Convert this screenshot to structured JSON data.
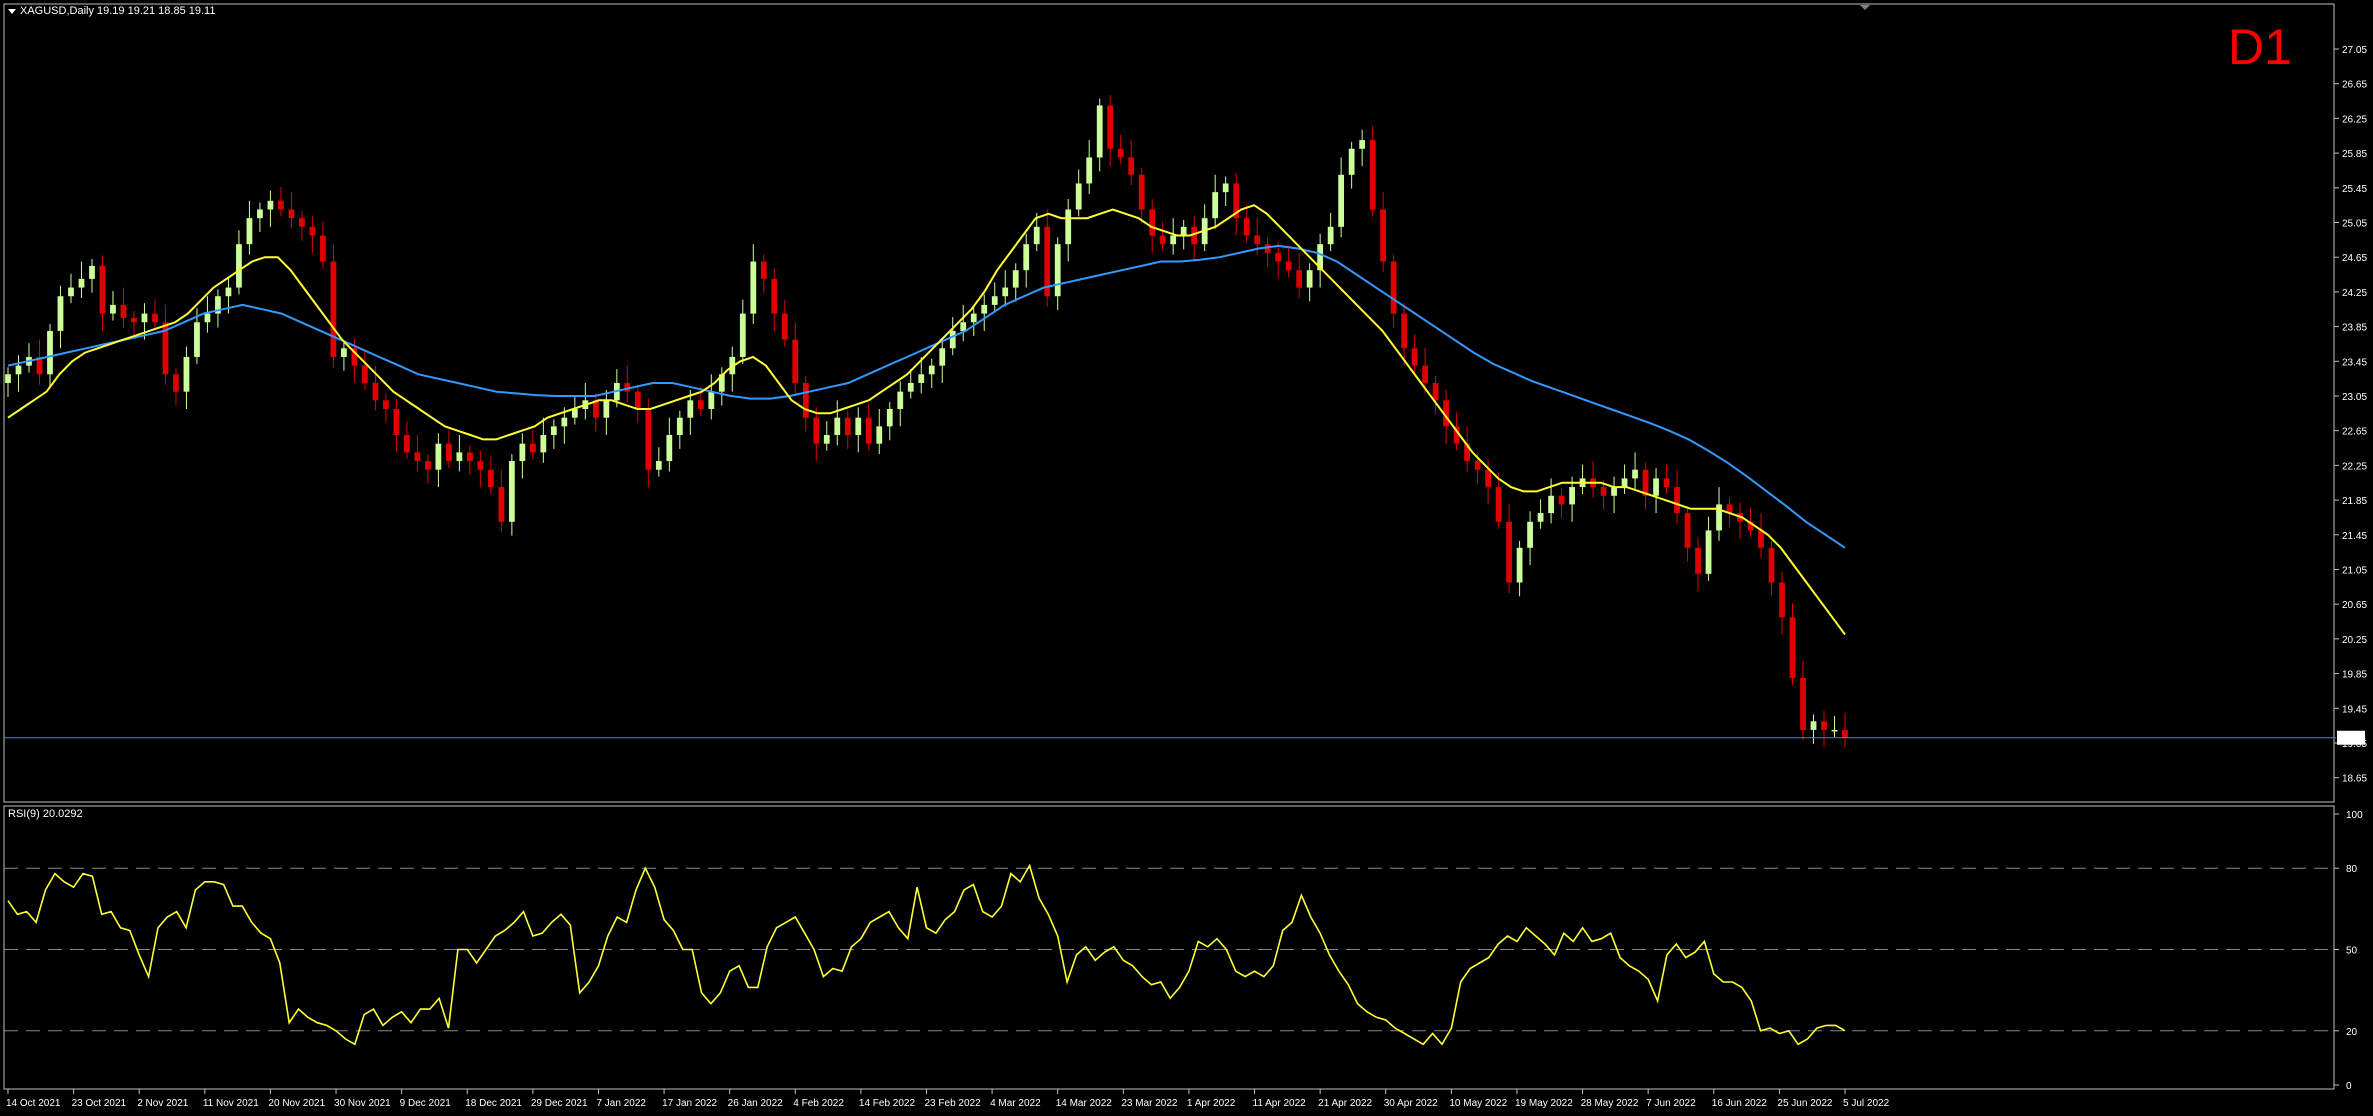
{
  "header": {
    "symbol_line": "XAGUSD,Daily  19.19 19.21 18.85 19.11",
    "timeframe_badge": "D1",
    "rsi_line": "RSI(9) 20.0292"
  },
  "colors": {
    "background": "#000000",
    "bull_candle": "#ccff99",
    "bear_candle": "#e00000",
    "fast_ma": "#ffff33",
    "slow_ma": "#3399ff",
    "rsi": "#ffff33",
    "grid_level": "#888888",
    "current_price_line": "#5a82b4"
  },
  "chart_data": [
    {
      "type": "candlestick",
      "symbol": "XAGUSD",
      "timeframe": "Daily",
      "ylim": [
        18.6,
        27.2
      ],
      "y_ticks": [
        "27.05",
        "26.65",
        "26.25",
        "25.85",
        "25.45",
        "25.05",
        "24.65",
        "24.25",
        "23.85",
        "23.45",
        "23.05",
        "22.65",
        "22.25",
        "21.85",
        "21.45",
        "21.05",
        "20.65",
        "20.25",
        "19.85",
        "19.45",
        "19.05",
        "18.65"
      ],
      "current_price": "19.11",
      "x_ticks": [
        "14 Oct 2021",
        "23 Oct 2021",
        "2 Nov 2021",
        "11 Nov 2021",
        "20 Nov 2021",
        "30 Nov 2021",
        "9 Dec 2021",
        "18 Dec 2021",
        "29 Dec 2021",
        "7 Jan 2022",
        "17 Jan 2022",
        "26 Jan 2022",
        "4 Feb 2022",
        "14 Feb 2022",
        "23 Feb 2022",
        "4 Mar 2022",
        "14 Mar 2022",
        "23 Mar 2022",
        "1 Apr 2022",
        "11 Apr 2022",
        "21 Apr 2022",
        "30 Apr 2022",
        "10 May 2022",
        "19 May 2022",
        "28 May 2022",
        "7 Jun 2022",
        "16 Jun 2022",
        "25 Jun 2022",
        "5 Jul 2022"
      ],
      "close": [
        23.3,
        23.4,
        23.5,
        23.3,
        23.8,
        24.2,
        24.3,
        24.4,
        24.55,
        24.0,
        24.1,
        23.95,
        23.9,
        24.0,
        23.9,
        23.3,
        23.1,
        23.5,
        23.9,
        24.0,
        24.2,
        24.3,
        24.8,
        25.1,
        25.2,
        25.3,
        25.2,
        25.1,
        25.0,
        24.9,
        24.6,
        23.5,
        23.6,
        23.4,
        23.2,
        23.0,
        22.9,
        22.6,
        22.4,
        22.3,
        22.2,
        22.5,
        22.3,
        22.4,
        22.3,
        22.2,
        22.0,
        21.6,
        22.3,
        22.5,
        22.4,
        22.6,
        22.7,
        22.8,
        22.9,
        23.0,
        22.8,
        23.0,
        23.2,
        23.1,
        22.9,
        22.2,
        22.3,
        22.6,
        22.8,
        23.0,
        22.9,
        23.1,
        23.3,
        23.5,
        24.0,
        24.6,
        24.4,
        24.0,
        23.7,
        23.2,
        22.8,
        22.5,
        22.6,
        22.8,
        22.6,
        22.8,
        22.5,
        22.7,
        22.9,
        23.1,
        23.2,
        23.3,
        23.4,
        23.6,
        23.8,
        23.9,
        24.0,
        24.1,
        24.2,
        24.3,
        24.5,
        24.8,
        25.0,
        24.2,
        24.8,
        25.2,
        25.5,
        25.8,
        26.4,
        25.9,
        25.8,
        25.6,
        25.2,
        24.9,
        24.8,
        24.9,
        25.0,
        24.8,
        25.1,
        25.4,
        25.5,
        25.1,
        24.9,
        24.8,
        24.7,
        24.6,
        24.5,
        24.3,
        24.5,
        24.8,
        25.0,
        25.6,
        25.9,
        26.0,
        25.2,
        24.6,
        24.0,
        23.6,
        23.4,
        23.2,
        23.0,
        22.7,
        22.5,
        22.3,
        22.2,
        22.0,
        21.6,
        20.9,
        21.3,
        21.6,
        21.7,
        21.9,
        21.8,
        22.0,
        22.1,
        22.0,
        21.9,
        22.0,
        22.1,
        22.2,
        21.9,
        22.1,
        22.0,
        21.7,
        21.3,
        21.0,
        21.5,
        21.8,
        21.7,
        21.6,
        21.5,
        21.3,
        20.9,
        20.5,
        19.8,
        19.2,
        19.3,
        19.2,
        19.2,
        19.11
      ],
      "series": [
        {
          "name": "fast MA",
          "values": [
            22.8,
            22.9,
            23.0,
            23.1,
            23.3,
            23.45,
            23.55,
            23.6,
            23.65,
            23.7,
            23.75,
            23.8,
            23.85,
            23.9,
            24.0,
            24.15,
            24.3,
            24.4,
            24.5,
            24.6,
            24.65,
            24.65,
            24.5,
            24.3,
            24.1,
            23.9,
            23.7,
            23.55,
            23.4,
            23.25,
            23.1,
            23.0,
            22.9,
            22.8,
            22.7,
            22.65,
            22.6,
            22.55,
            22.55,
            22.6,
            22.65,
            22.7,
            22.8,
            22.85,
            22.9,
            22.95,
            23.0,
            23.0,
            22.95,
            22.9,
            22.9,
            22.95,
            23.0,
            23.05,
            23.1,
            23.2,
            23.35,
            23.45,
            23.5,
            23.4,
            23.2,
            23.0,
            22.9,
            22.85,
            22.85,
            22.9,
            22.95,
            23.0,
            23.1,
            23.2,
            23.3,
            23.45,
            23.6,
            23.75,
            23.9,
            24.05,
            24.25,
            24.5,
            24.7,
            24.9,
            25.1,
            25.15,
            25.1,
            25.1,
            25.1,
            25.15,
            25.2,
            25.15,
            25.1,
            25.0,
            24.95,
            24.9,
            24.9,
            24.95,
            25.0,
            25.1,
            25.2,
            25.25,
            25.15,
            25.0,
            24.85,
            24.7,
            24.55,
            24.4,
            24.25,
            24.1,
            23.95,
            23.8,
            23.6,
            23.4,
            23.2,
            23.0,
            22.8,
            22.6,
            22.4,
            22.25,
            22.1,
            22.0,
            21.95,
            21.95,
            22.0,
            22.05,
            22.05,
            22.05,
            22.05,
            22.0,
            22.0,
            21.95,
            21.9,
            21.85,
            21.8,
            21.75,
            21.75,
            21.75,
            21.7,
            21.65,
            21.55,
            21.45,
            21.3,
            21.1,
            20.9,
            20.7,
            20.5,
            20.3
          ]
        },
        {
          "name": "slow MA",
          "values": [
            23.4,
            23.45,
            23.5,
            23.55,
            23.6,
            23.65,
            23.7,
            23.75,
            23.8,
            23.9,
            24.0,
            24.05,
            24.1,
            24.05,
            24.0,
            23.9,
            23.8,
            23.7,
            23.6,
            23.5,
            23.4,
            23.3,
            23.25,
            23.2,
            23.15,
            23.1,
            23.08,
            23.06,
            23.05,
            23.05,
            23.05,
            23.1,
            23.15,
            23.2,
            23.2,
            23.15,
            23.1,
            23.05,
            23.02,
            23.02,
            23.05,
            23.1,
            23.15,
            23.2,
            23.3,
            23.4,
            23.5,
            23.6,
            23.7,
            23.8,
            23.95,
            24.1,
            24.2,
            24.3,
            24.35,
            24.4,
            24.45,
            24.5,
            24.55,
            24.6,
            24.6,
            24.62,
            24.65,
            24.7,
            24.75,
            24.78,
            24.75,
            24.7,
            24.6,
            24.45,
            24.3,
            24.15,
            24.0,
            23.85,
            23.7,
            23.55,
            23.42,
            23.32,
            23.22,
            23.14,
            23.06,
            22.98,
            22.9,
            22.82,
            22.74,
            22.65,
            22.55,
            22.42,
            22.28,
            22.12,
            21.95,
            21.78,
            21.6,
            21.45,
            21.3
          ]
        }
      ]
    },
    {
      "type": "line",
      "title": "RSI(9) 20.0292",
      "ylim": [
        0,
        100
      ],
      "y_ticks": [
        "100",
        "80",
        "50",
        "20",
        "0"
      ],
      "levels": [
        20,
        50,
        80
      ],
      "series": [
        {
          "name": "RSI(9)",
          "values": [
            68,
            63,
            64,
            60,
            72,
            78,
            75,
            73,
            78,
            77,
            63,
            64,
            58,
            57,
            48,
            40,
            58,
            62,
            64,
            58,
            72,
            75,
            75,
            74,
            66,
            66,
            60,
            56,
            54,
            45,
            23,
            28,
            25,
            23,
            22,
            20,
            17,
            15,
            26,
            28,
            22,
            25,
            27,
            23,
            28,
            28,
            32,
            21,
            50,
            50,
            45,
            50,
            55,
            57,
            60,
            64,
            55,
            56,
            60,
            63,
            59,
            34,
            38,
            44,
            55,
            62,
            60,
            72,
            80,
            73,
            61,
            57,
            50,
            50,
            34,
            30,
            34,
            42,
            44,
            36,
            36,
            51,
            58,
            60,
            62,
            56,
            50,
            40,
            43,
            42,
            51,
            54,
            60,
            62,
            64,
            58,
            54,
            73,
            58,
            56,
            61,
            64,
            72,
            74,
            64,
            62,
            66,
            78,
            75,
            81,
            69,
            63,
            55,
            38,
            48,
            51,
            46,
            49,
            51,
            46,
            44,
            40,
            37,
            38,
            32,
            36,
            42,
            53,
            51,
            54,
            50,
            42,
            40,
            42,
            40,
            44,
            57,
            60,
            70,
            62,
            56,
            48,
            42,
            37,
            30,
            27,
            25,
            24,
            21,
            19,
            17,
            15,
            19,
            15,
            21,
            38,
            43,
            45,
            47,
            52,
            55,
            53,
            58,
            55,
            52,
            48,
            56,
            53,
            58,
            53,
            54,
            56,
            47,
            44,
            42,
            39,
            31,
            48,
            52,
            47,
            49,
            53,
            41,
            38,
            38,
            36,
            31,
            20,
            21,
            19,
            20,
            15,
            17,
            21,
            22,
            22,
            20.03
          ]
        }
      ]
    }
  ]
}
